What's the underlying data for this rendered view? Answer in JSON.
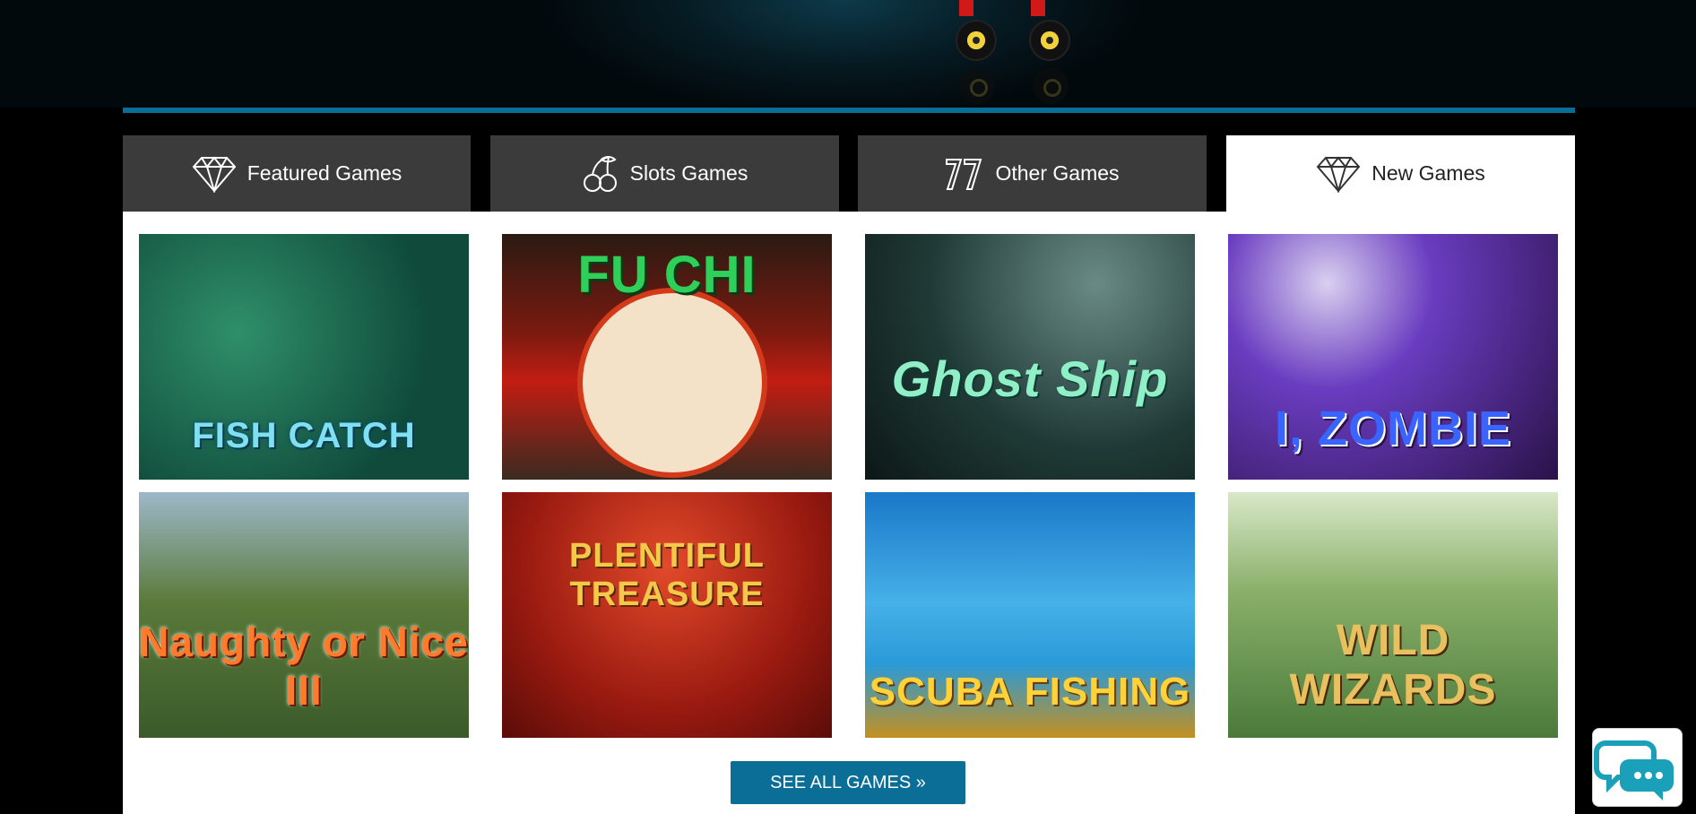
{
  "tabs": [
    {
      "label": "Featured Games",
      "icon": "diamond-icon",
      "active": false
    },
    {
      "label": "Slots Games",
      "icon": "cherries-icon",
      "active": false
    },
    {
      "label": "Other Games",
      "icon": "sevens-icon",
      "active": false
    },
    {
      "label": "New Games",
      "icon": "diamond-icon",
      "active": true
    }
  ],
  "games": [
    {
      "title": "FISH CATCH"
    },
    {
      "title": "FU CHI"
    },
    {
      "title": "Ghost Ship"
    },
    {
      "title": "I, ZOMBIE"
    },
    {
      "title": "Naughty or Nice III"
    },
    {
      "title": "PLENTIFUL TREASURE"
    },
    {
      "title": "SCUBA FISHING"
    },
    {
      "title": "WILD WIZARDS"
    }
  ],
  "see_all_label": "SEE ALL GAMES »",
  "colors": {
    "accent": "#0a6e96",
    "tab_bg": "#3b3b3b",
    "tab_active_bg": "#ffffff"
  },
  "chat": {
    "icon": "chat-bubbles-icon"
  }
}
